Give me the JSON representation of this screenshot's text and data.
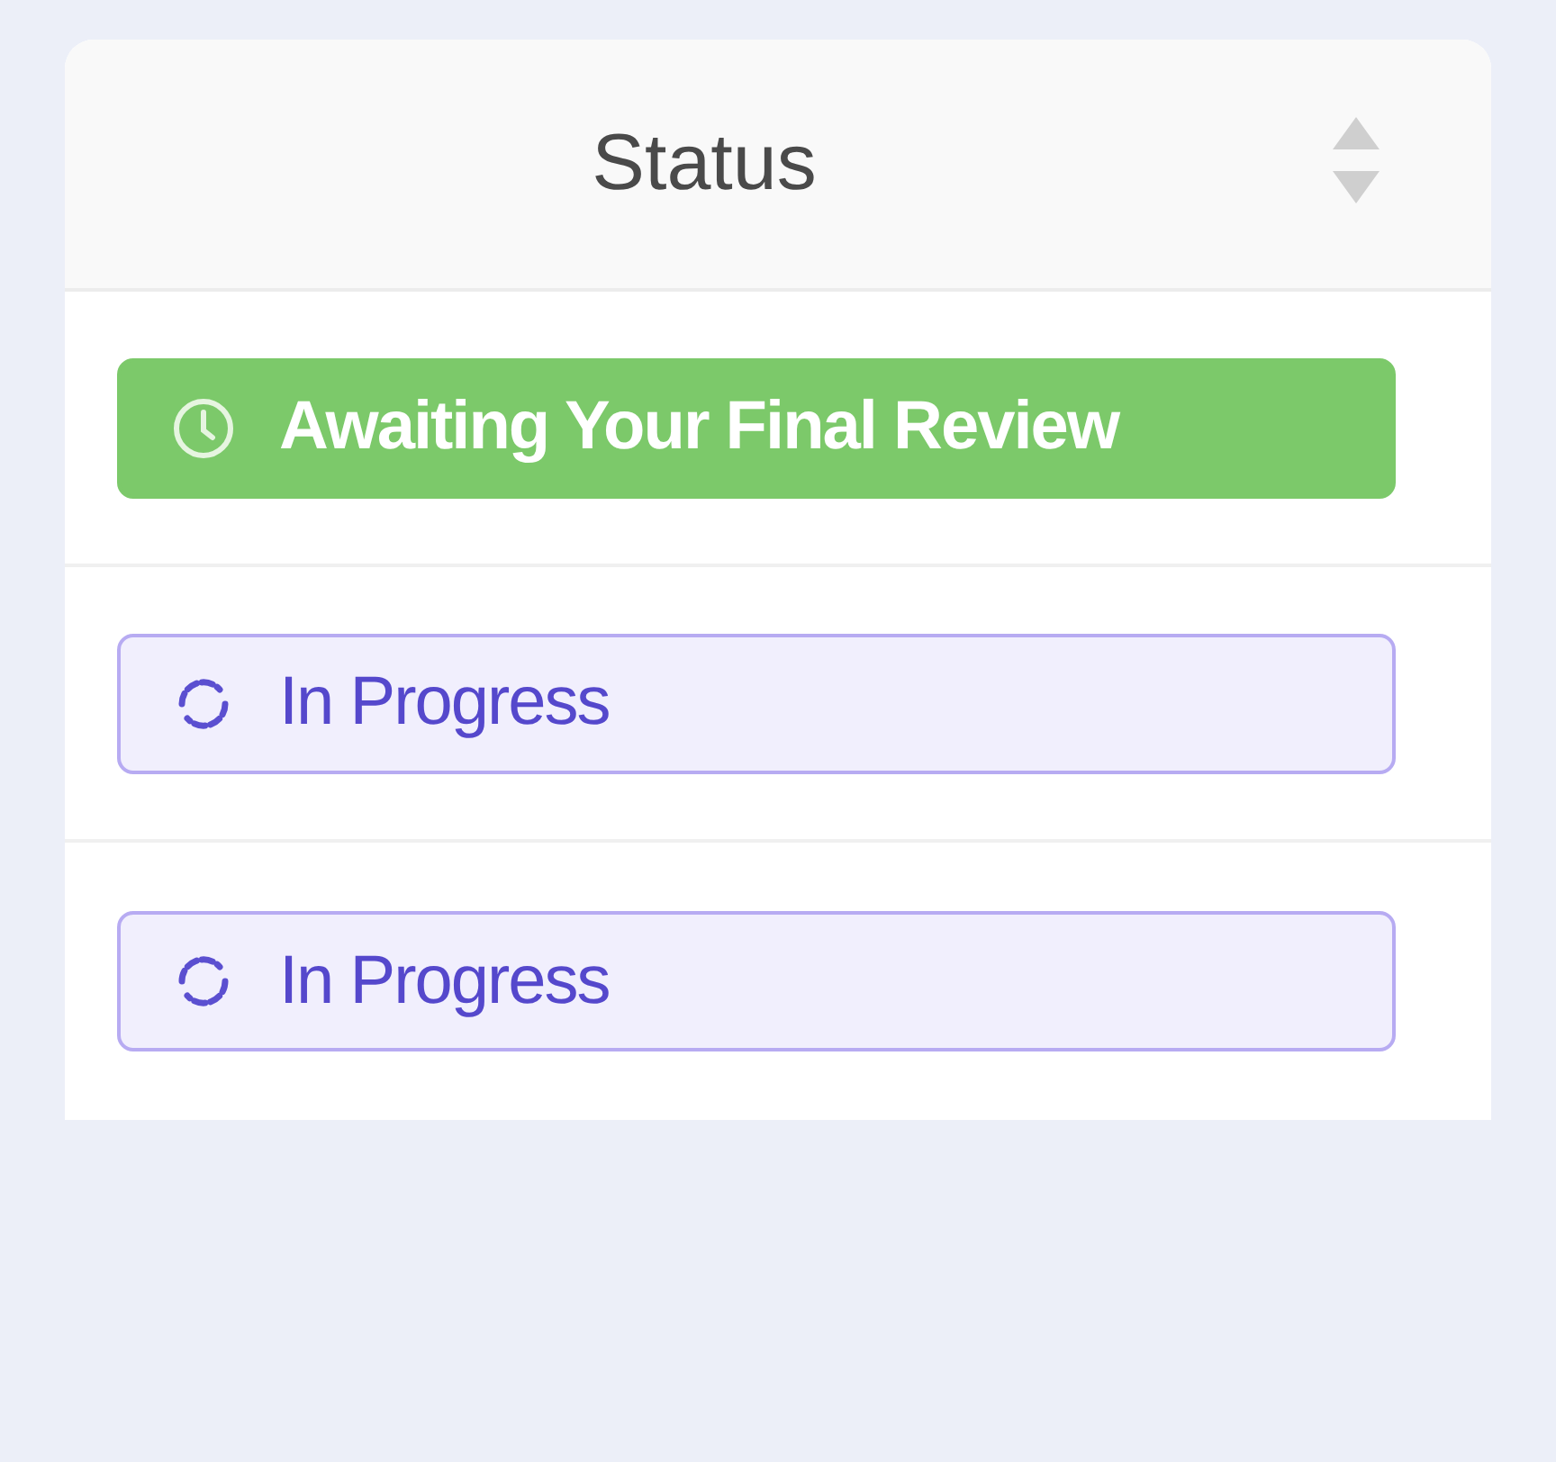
{
  "table": {
    "columns": [
      {
        "label": "Status",
        "sortable": true
      }
    ],
    "rows": [
      {
        "status": {
          "label": "Awaiting Your Final Review",
          "kind": "review"
        }
      },
      {
        "status": {
          "label": "In Progress",
          "kind": "progress"
        }
      },
      {
        "status": {
          "label": "In Progress",
          "kind": "progress"
        }
      }
    ]
  }
}
